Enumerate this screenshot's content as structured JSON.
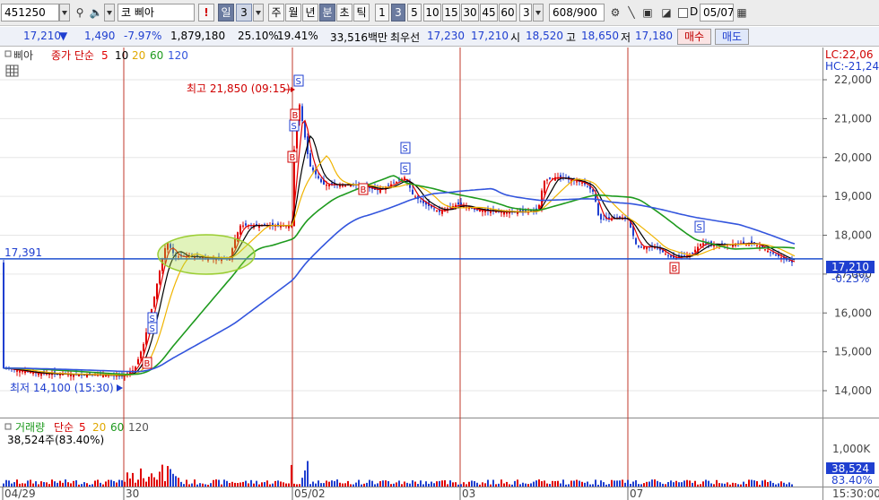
{
  "toolbar": {
    "code": "451250",
    "market_tag": "코",
    "stock_name": "삐아",
    "period_tabs": [
      "일",
      "3",
      "주",
      "월",
      "년",
      "분",
      "초",
      "틱"
    ],
    "selected_tab": "3",
    "minute_options": [
      "1",
      "3",
      "5",
      "10",
      "15",
      "30",
      "45",
      "60",
      "3"
    ],
    "selected_minute": "3",
    "count": "608/900",
    "date_value": "05/07",
    "checkbox_label": "D",
    "exclamation": "!"
  },
  "quote": {
    "price": "17,210",
    "change": "1,490",
    "change_pct": "-7.97%",
    "volume": "1,879,180",
    "pct1": "25.10%",
    "pct2": "19.41%",
    "amount": "33,516백만",
    "bid_label": "최우선",
    "bid1": "17,230",
    "bid2": "17,210",
    "open_label": "시",
    "open": "18,520",
    "high_label": "고",
    "high": "18,650",
    "low_label": "저",
    "low": "17,180",
    "buy_label": "매수",
    "sell_label": "매도"
  },
  "legend": {
    "name": "삐아",
    "indicator": "종가 단순",
    "ma_periods": [
      "5",
      "10",
      "20",
      "60",
      "120"
    ],
    "ma_colors": [
      "#e00000",
      "#000000",
      "#f0b400",
      "#1e9a1e",
      "#3355dd"
    ]
  },
  "price_axis": {
    "ticks": [
      "22,000",
      "21,000",
      "20,000",
      "19,000",
      "18,000",
      "17,000",
      "16,000",
      "15,000",
      "14,000"
    ],
    "lc": "LC:22,06",
    "hc": "HC:-21,24",
    "current": "17,210",
    "current_pct": "-0.23%"
  },
  "annotations": {
    "high": "최고 21,850 (09:15)",
    "low": "최저 14,100 (15:30)",
    "level_line": "17,391"
  },
  "volume_panel": {
    "label": "거래량",
    "indicator": "단순",
    "ma_periods": [
      "5",
      "20",
      "60",
      "120"
    ],
    "value_text": "38,524주(83.40%)",
    "axis_tick": "1,000K",
    "current": "38,524",
    "current_pct": "83.40%"
  },
  "x_axis": {
    "labels": [
      "04/29",
      "30",
      "05/02",
      "03",
      "07"
    ],
    "time": "15:30:00"
  },
  "colors": {
    "bull": "#e00000",
    "bear": "#1f3fd0",
    "level": "#1e50d0",
    "day_sep": "#c0392b"
  }
}
